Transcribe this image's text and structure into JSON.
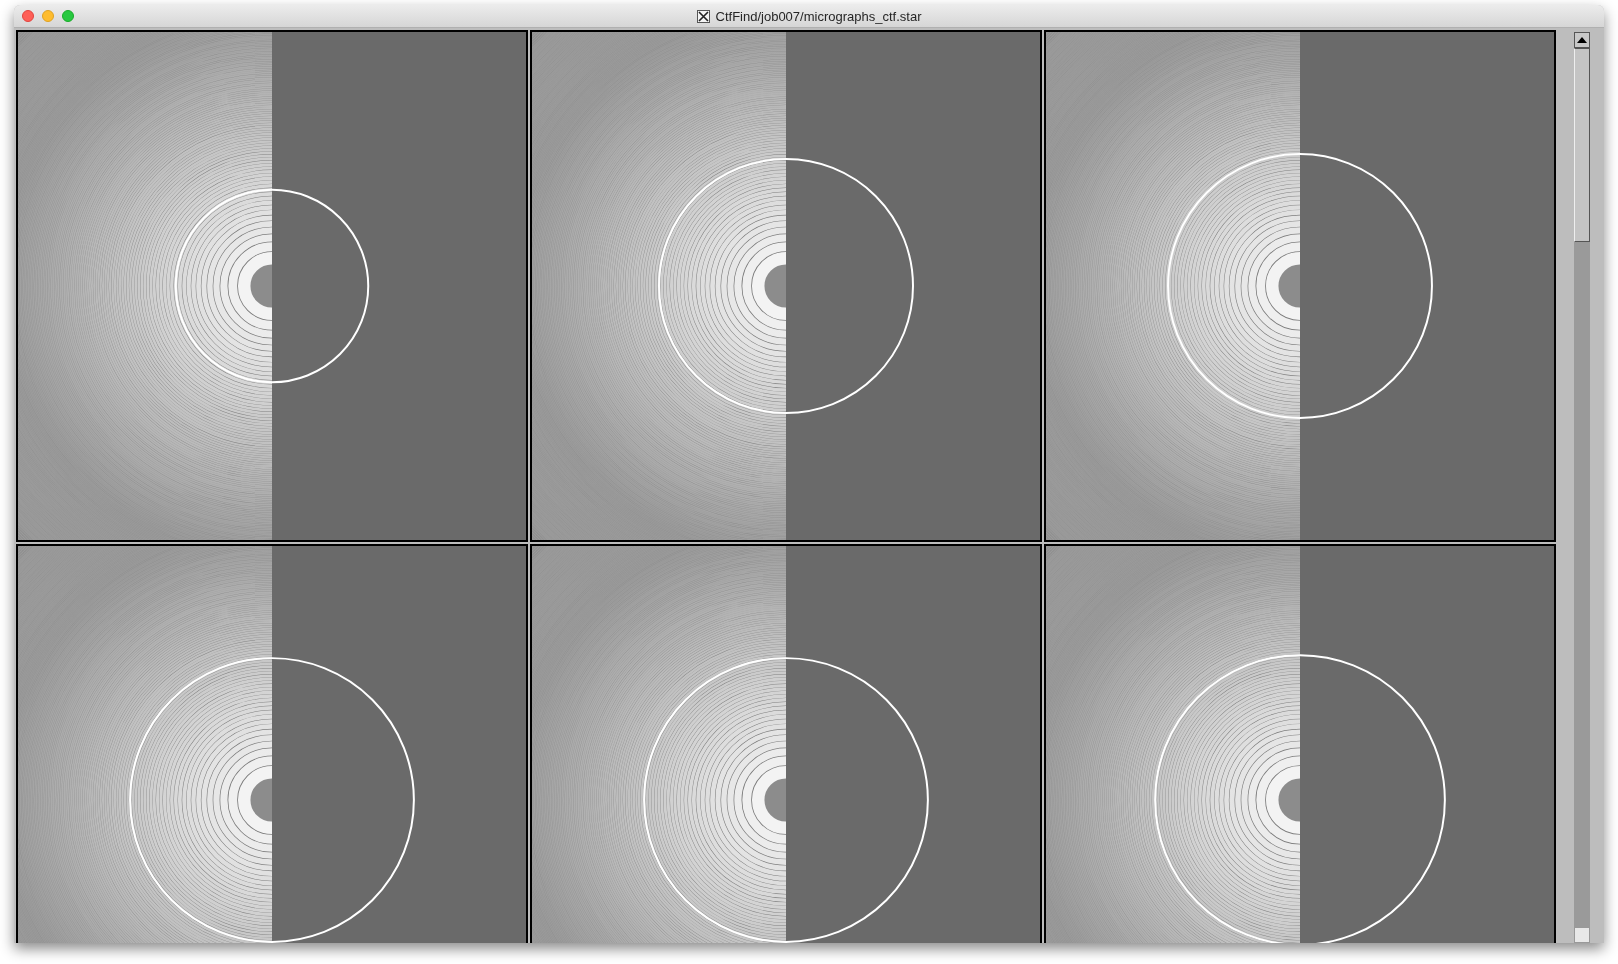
{
  "window": {
    "title": "CtfFind/job007/micrographs_ctf.star"
  }
}
